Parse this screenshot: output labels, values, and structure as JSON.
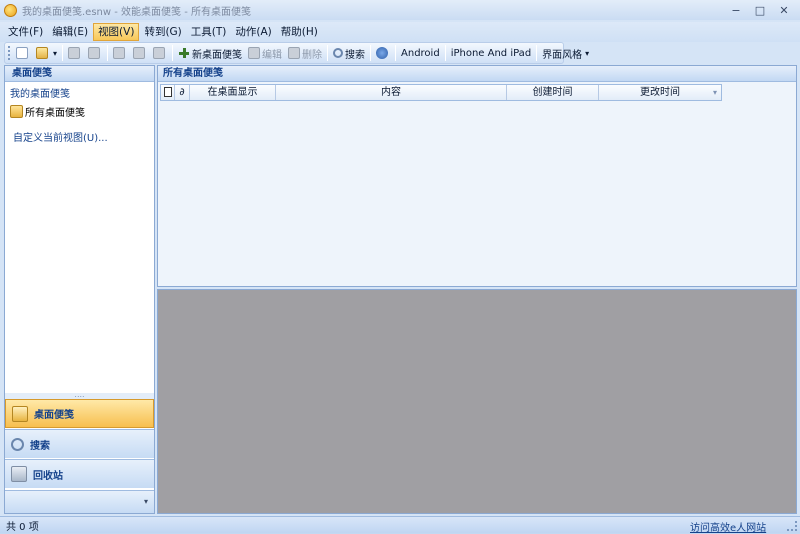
{
  "window": {
    "title": "我的桌面便笺.esnw - 效能桌面便笺 - 所有桌面便笺",
    "controls": {
      "minimize": "−",
      "maximize": "□",
      "close": "✕"
    }
  },
  "menubar": {
    "items": [
      {
        "label": "文件(F)"
      },
      {
        "label": "编辑(E)"
      },
      {
        "label": "视图(V)"
      },
      {
        "label": "转到(G)"
      },
      {
        "label": "工具(T)"
      },
      {
        "label": "动作(A)"
      },
      {
        "label": "帮助(H)"
      }
    ],
    "active_index": 2
  },
  "toolbar": {
    "new_note": "新桌面便笺",
    "edit": "编辑",
    "delete": "删除",
    "search": "搜索",
    "android": "Android",
    "iphone": "iPhone And iPad",
    "theme": "界面风格"
  },
  "left_panel": {
    "header": "桌面便笺",
    "section": "我的桌面便笺",
    "items": [
      {
        "label": "所有桌面便笺"
      }
    ],
    "customize_link": "自定义当前视图(U)...",
    "splitter": "....",
    "nav": {
      "notes": "桌面便笺",
      "search": "搜索",
      "recycle": "回收站",
      "more": "▾"
    }
  },
  "main_panel": {
    "header": "所有桌面便笺",
    "columns": {
      "doc_icon": "doc-icon",
      "attach_icon": "paperclip-icon",
      "show_on_desktop": "在桌面显示",
      "content": "内容",
      "created": "创建时间",
      "modified": "更改时间"
    }
  },
  "statusbar": {
    "count": "共 0 项",
    "link": "访问高效e人网站"
  },
  "colors": {
    "accent": "#15428b",
    "selected": "#f7bf4f",
    "preview_bg": "#a09fa3"
  }
}
